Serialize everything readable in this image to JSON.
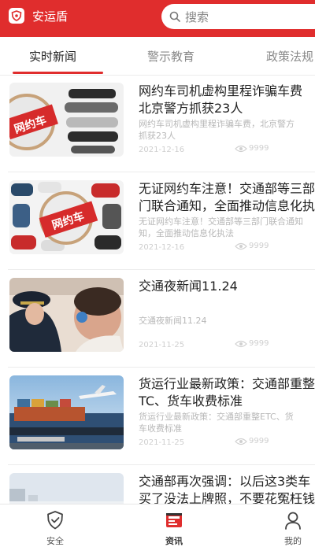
{
  "header": {
    "app_name": "安运盾",
    "logo_icon": "shield-logo-icon",
    "search_placeholder": "搜索",
    "brand_color": "#e02d2d"
  },
  "tabs": [
    {
      "label": "实时新闻",
      "active": true
    },
    {
      "label": "警示教育",
      "active": false
    },
    {
      "label": "政策法规",
      "active": false
    }
  ],
  "news": [
    {
      "title_lines": [
        "网约车司机虚构里程诈骗车费",
        "北京警方抓获23人"
      ],
      "summary_lines": [
        "网约车司机虚构里程诈骗车费，北京警方",
        "抓获23人"
      ],
      "date": "2021-12-16",
      "views": "9999",
      "thumb_text": "网约车"
    },
    {
      "title_lines": [
        "无证网约车注意！交通部等三部",
        "门联合通知，全面推动信息化执法"
      ],
      "summary_lines": [
        "无证网约车注意！交通部等三部门联合通知",
        "知，全面推动信息化执法"
      ],
      "date": "2021-12-16",
      "views": "9999",
      "thumb_text": "网约车"
    },
    {
      "title_lines": [
        "交通夜新闻11.24"
      ],
      "summary_lines": [
        "交通夜新闻11.24"
      ],
      "date": "2021-11-25",
      "views": "9999",
      "thumb_text": ""
    },
    {
      "title_lines": [
        "货运行业最新政策：交通部重整ET",
        "TC、货车收费标准"
      ],
      "summary_lines": [
        "货运行业最新政策：交通部重整ETC、货",
        "车收费标准"
      ],
      "date": "2021-11-25",
      "views": "9999",
      "thumb_text": ""
    },
    {
      "title_lines": [
        "交通部再次强调：以后这3类车",
        "买了没法上牌照，不要花冤枉钱"
      ],
      "summary_lines": [],
      "date": "",
      "views": "",
      "thumb_text": ""
    }
  ],
  "bottom_nav": [
    {
      "label": "安全",
      "icon": "shield-check-icon",
      "active": false
    },
    {
      "label": "资讯",
      "icon": "news-icon",
      "active": true
    },
    {
      "label": "我的",
      "icon": "user-icon",
      "active": false
    }
  ]
}
